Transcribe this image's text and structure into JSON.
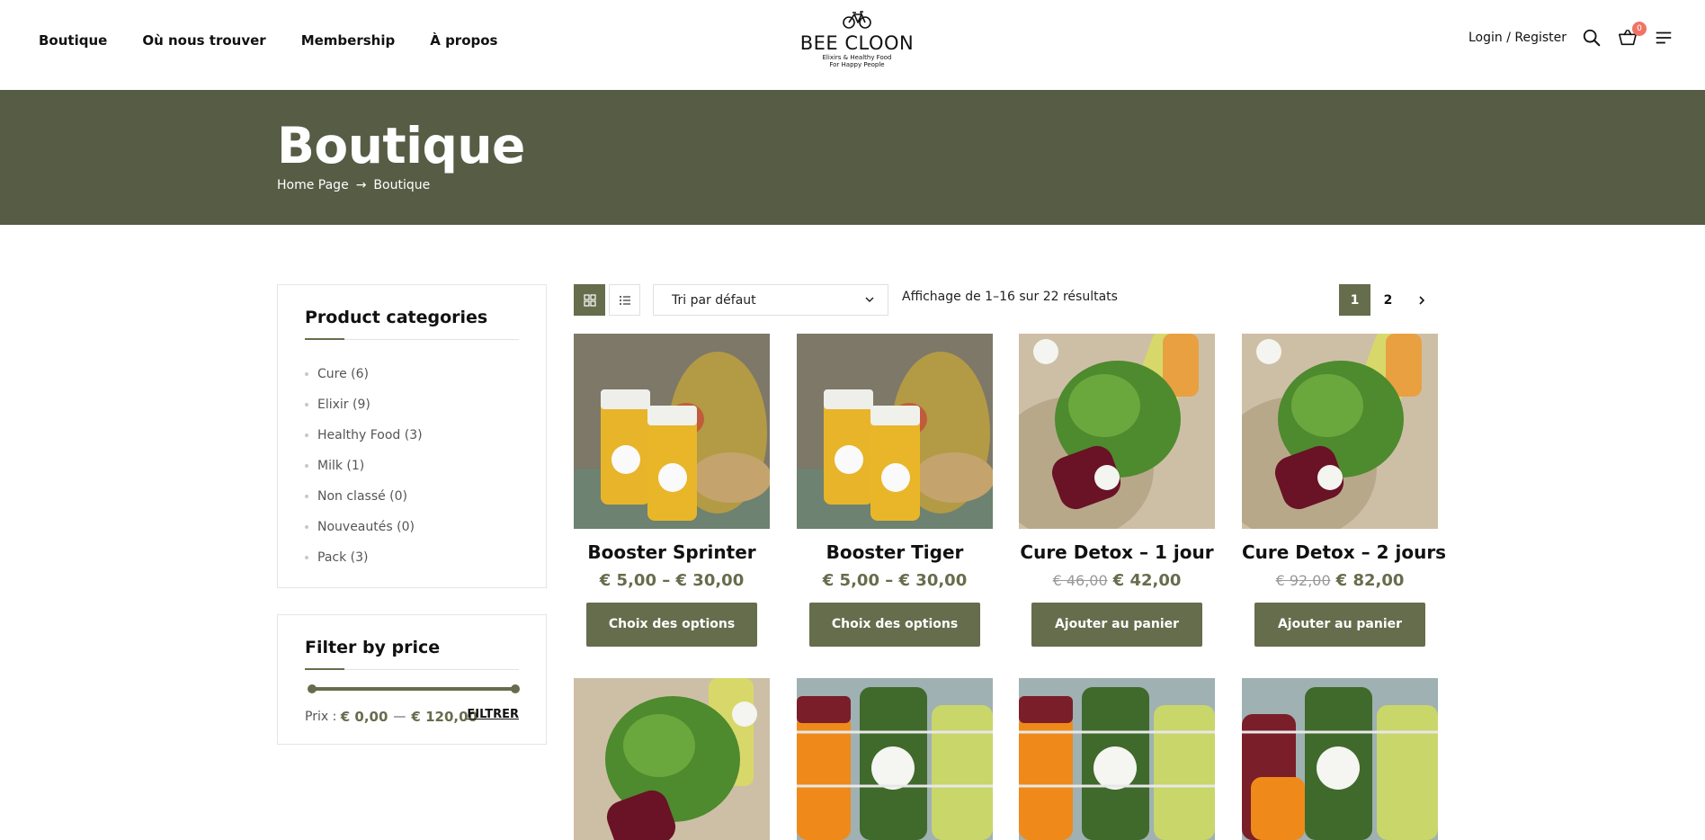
{
  "nav": {
    "items": [
      "Boutique",
      "Où nous trouver",
      "Membership",
      "À propos"
    ]
  },
  "logo": {
    "name": "BEE CLOON",
    "tagline_line1": "Elixirs & Healthy Food",
    "tagline_line2": "For Happy People"
  },
  "header": {
    "login_label": "Login / Register",
    "cart_count": "0"
  },
  "hero": {
    "title": "Boutique",
    "breadcrumb": [
      "Home Page",
      "→",
      "Boutique"
    ]
  },
  "sidebar": {
    "categories_title": "Product categories",
    "categories": [
      {
        "label": "Cure (6)"
      },
      {
        "label": "Elixir (9)"
      },
      {
        "label": "Healthy Food (3)"
      },
      {
        "label": "Milk (1)"
      },
      {
        "label": "Non classé (0)"
      },
      {
        "label": "Nouveautés (0)"
      },
      {
        "label": "Pack (3)"
      }
    ],
    "price_title": "Filter by price",
    "price_label": "Prix :",
    "price_min": "€ 0,00",
    "price_separator": "—",
    "price_max": "€ 120,00",
    "filter_label": "FILTRER"
  },
  "toolbar": {
    "sort_value": "Tri par défaut",
    "result_count": "Affichage de 1–16 sur 22 résultats",
    "pages": [
      "1",
      "2"
    ]
  },
  "products": [
    {
      "name": "Booster Sprinter",
      "price": "€ 5,00 – € 30,00",
      "old_price": "",
      "button": "Choix des options"
    },
    {
      "name": "Booster Tiger",
      "price": "€ 5,00 – € 30,00",
      "old_price": "",
      "button": "Choix des options"
    },
    {
      "name": "Cure Detox – 1 jour",
      "price": "€ 42,00",
      "old_price": "€ 46,00",
      "button": "Ajouter au panier"
    },
    {
      "name": "Cure Detox – 2 jours",
      "price": "€ 82,00",
      "old_price": "€ 92,00",
      "button": "Ajouter au panier"
    }
  ],
  "colors": {
    "brand_olive": "#666d4c",
    "hero_bg": "#575c45",
    "badge": "#f07466"
  }
}
